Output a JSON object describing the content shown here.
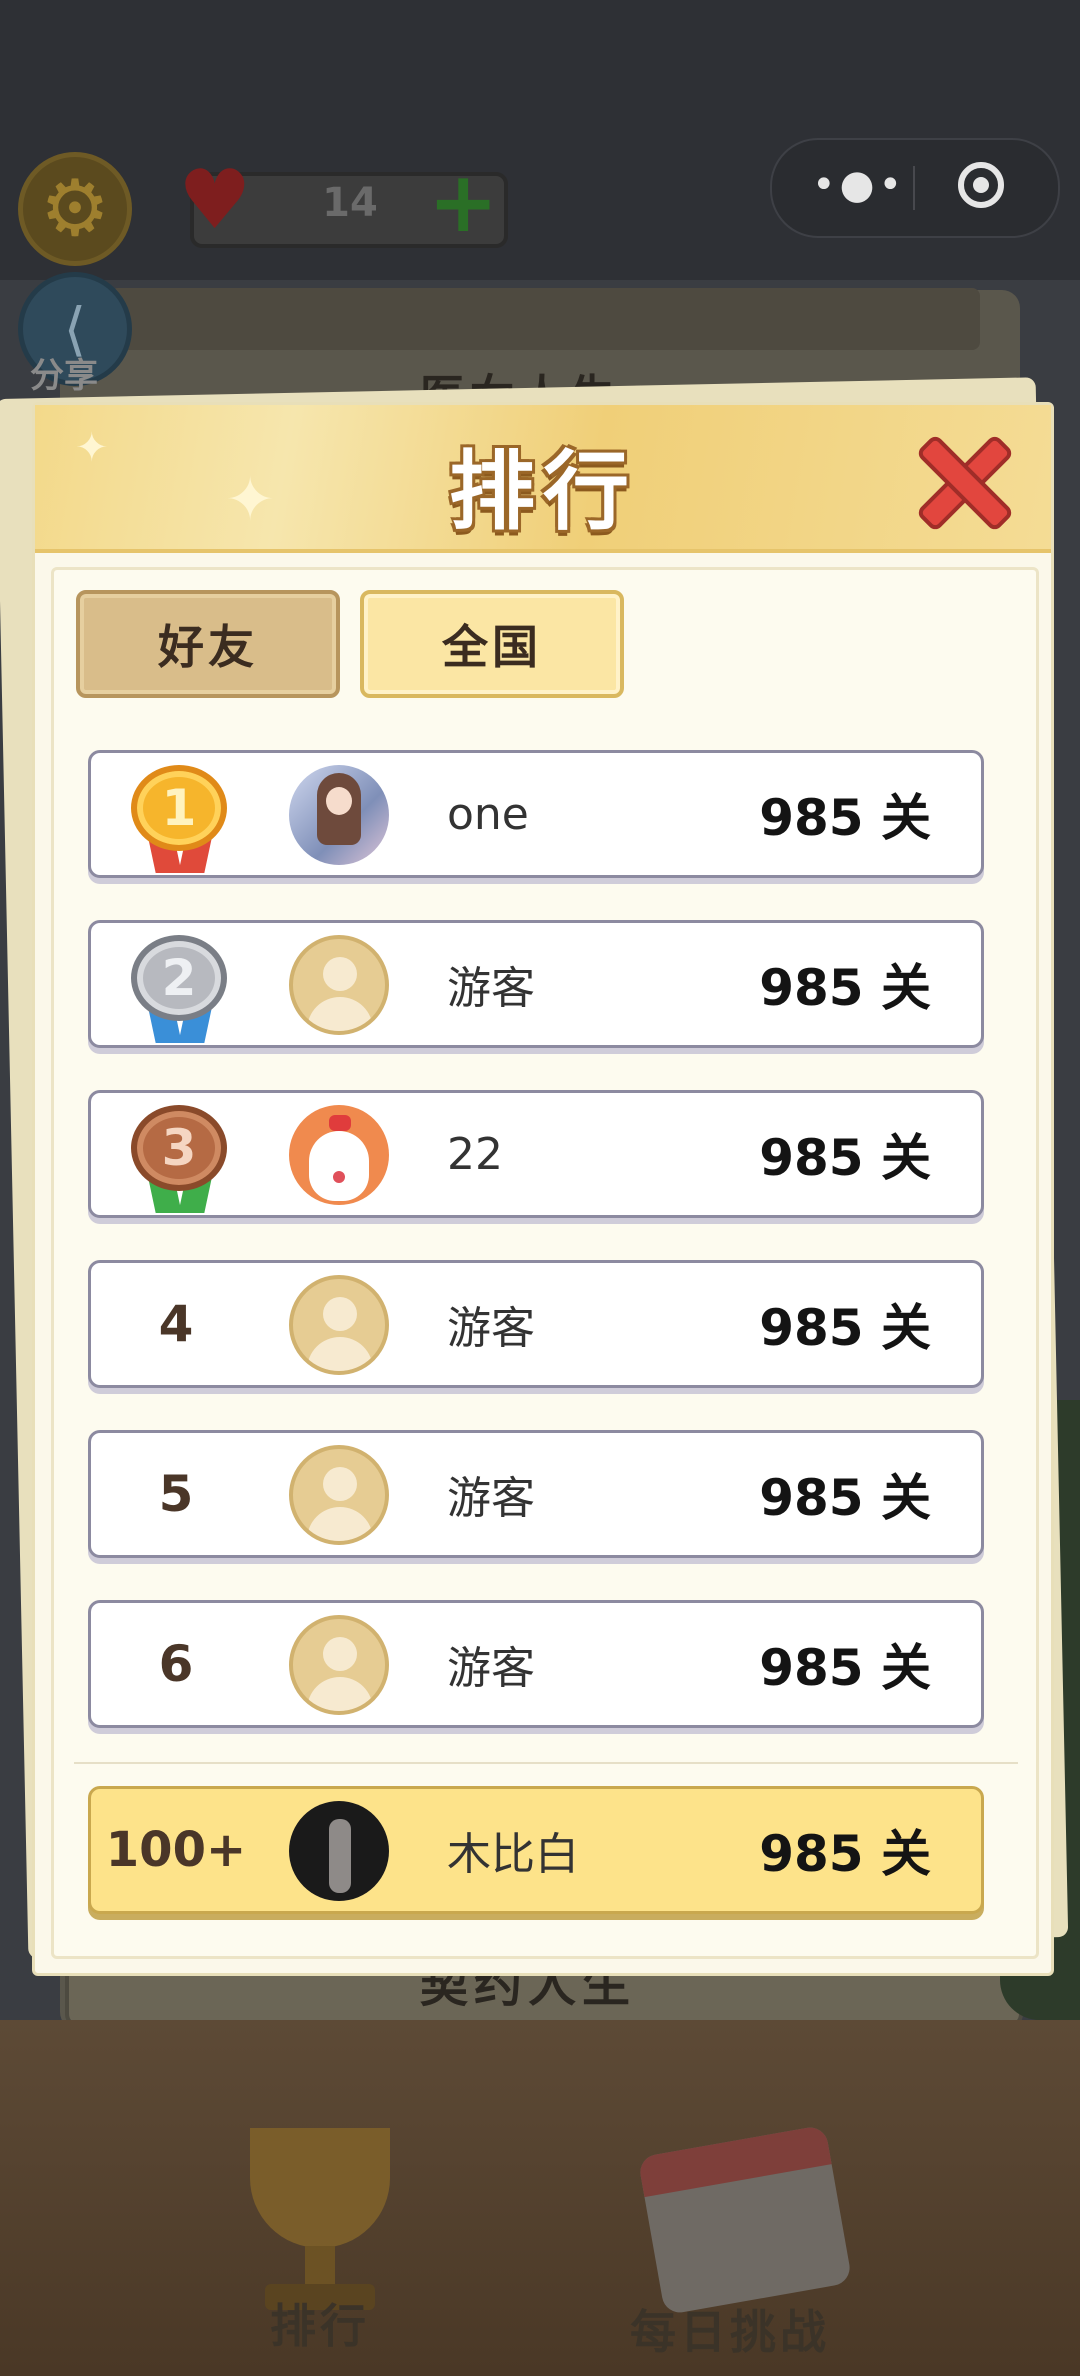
{
  "top_bar": {
    "lives_count": "14",
    "share_label": "分享"
  },
  "background": {
    "behind_title": "医女人生",
    "behind_bottom": "契约人生"
  },
  "modal": {
    "title": "排行",
    "tabs": [
      {
        "label": "好友",
        "selected": true
      },
      {
        "label": "全国",
        "selected": false
      }
    ],
    "entries": [
      {
        "rank": "1",
        "medal": "gold",
        "avatar": "anime-avatar",
        "name": "one",
        "score": "985 关"
      },
      {
        "rank": "2",
        "medal": "silver",
        "avatar": "default-avatar",
        "name": "游客",
        "score": "985 关"
      },
      {
        "rank": "3",
        "medal": "bronze",
        "avatar": "dog-avatar",
        "name": "22",
        "score": "985 关"
      },
      {
        "rank": "4",
        "avatar": "default-avatar",
        "name": "游客",
        "score": "985 关"
      },
      {
        "rank": "5",
        "avatar": "default-avatar",
        "name": "游客",
        "score": "985 关"
      },
      {
        "rank": "6",
        "avatar": "default-avatar",
        "name": "游客",
        "score": "985 关"
      }
    ],
    "self": {
      "rank": "100+",
      "avatar": "photo-avatar",
      "name": "木比白",
      "score": "985 关"
    }
  },
  "bottom_nav": {
    "rank_label": "排行",
    "daily_label": "每日挑战"
  },
  "colors": {
    "header_gold": "#f3d98a",
    "self_row": "#fde38a",
    "close_red": "#e2463e"
  }
}
